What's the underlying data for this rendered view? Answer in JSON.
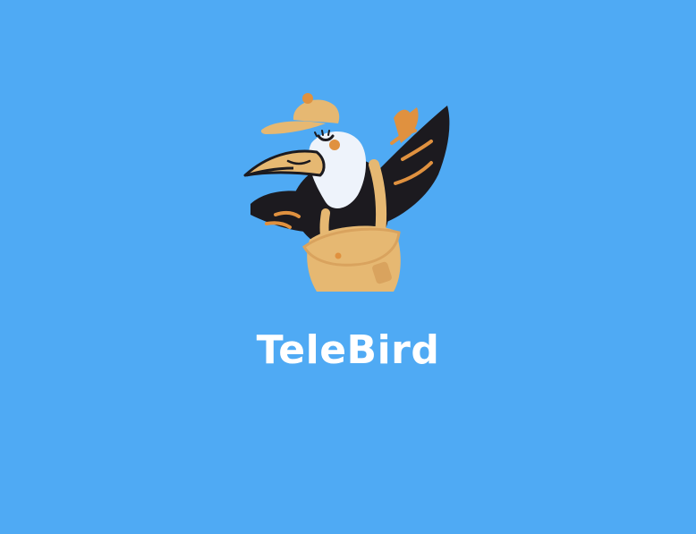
{
  "app": {
    "name": "TeleBird"
  },
  "logo": {
    "icon": "toucan-mail-carrier-icon"
  },
  "colors": {
    "background": "#4faaf4",
    "title": "#ffffff",
    "bag": "#e6b872",
    "accent_orange": "#e0913f",
    "feather_black": "#1c1a1f",
    "face_white": "#eef3fb"
  }
}
